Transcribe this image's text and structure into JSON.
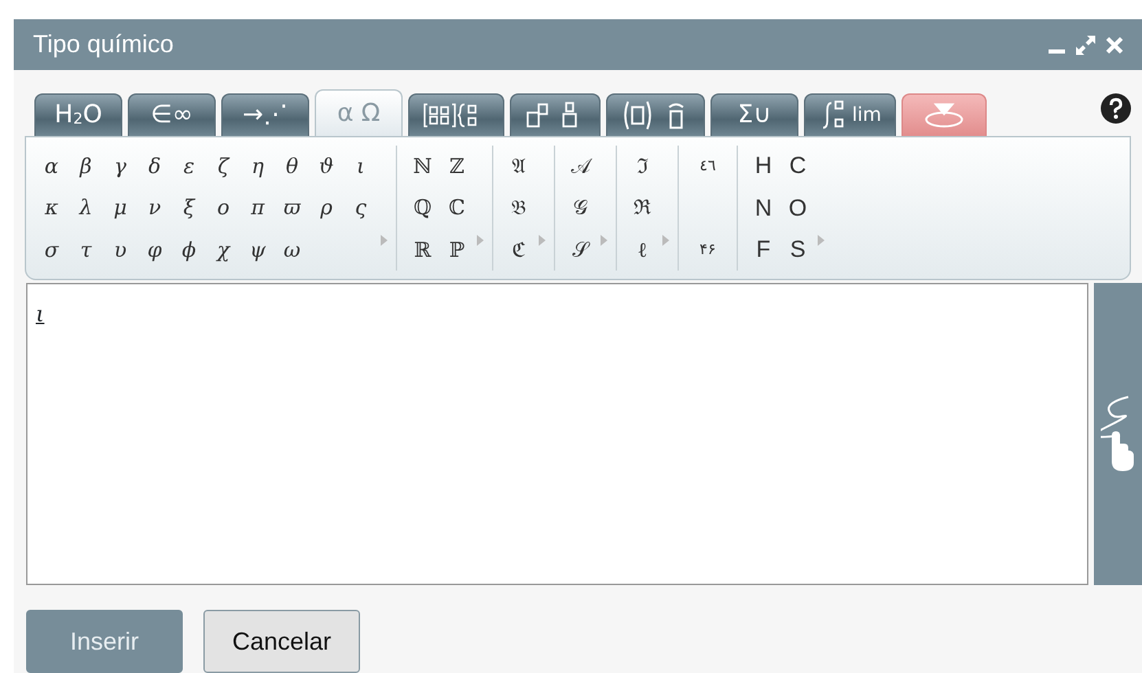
{
  "window": {
    "title": "Tipo químico"
  },
  "tabs": [
    {
      "kind": "text",
      "label": "H$_{2}$O",
      "selected": false
    },
    {
      "kind": "text",
      "label": "∈∞",
      "selected": false
    },
    {
      "kind": "text",
      "label": "→⋰",
      "selected": false
    },
    {
      "kind": "text",
      "label": "α Ω",
      "selected": true
    },
    {
      "kind": "matrix",
      "selected": false
    },
    {
      "kind": "scripts",
      "selected": false
    },
    {
      "kind": "brackets",
      "selected": false
    },
    {
      "kind": "text",
      "label": "Σ∪",
      "selected": false
    },
    {
      "kind": "calculus",
      "label": "lim",
      "selected": false
    },
    {
      "kind": "special",
      "selected": false
    }
  ],
  "palette": [
    {
      "kind": "greek",
      "expandable": true,
      "rows": [
        [
          "α",
          "β",
          "γ",
          "δ",
          "ε",
          "ζ",
          "η",
          "θ",
          "ϑ",
          "ι"
        ],
        [
          "κ",
          "λ",
          "μ",
          "ν",
          "ξ",
          "ο",
          "π",
          "ϖ",
          "ρ",
          "ς"
        ],
        [
          "σ",
          "τ",
          "υ",
          "φ",
          "ϕ",
          "χ",
          "ψ",
          "ω"
        ]
      ]
    },
    {
      "kind": "plain",
      "expandable": true,
      "rows": [
        [
          "ℕ",
          "ℤ"
        ],
        [
          "ℚ",
          "ℂ"
        ],
        [
          "ℝ",
          "ℙ"
        ]
      ]
    },
    {
      "kind": "plain",
      "expandable": true,
      "rows": [
        [
          "𝔄"
        ],
        [
          "𝔅"
        ],
        [
          "ℭ"
        ]
      ]
    },
    {
      "kind": "plain",
      "expandable": true,
      "rows": [
        [
          "𝒜"
        ],
        [
          "𝒢"
        ],
        [
          "𝒮"
        ]
      ]
    },
    {
      "kind": "plain",
      "expandable": true,
      "rows": [
        [
          "ℑ"
        ],
        [
          "ℜ"
        ],
        [
          "ℓ"
        ]
      ]
    },
    {
      "kind": "small",
      "expandable": false,
      "rows": [
        [
          "٤٦"
        ],
        [
          "۴۶"
        ]
      ]
    },
    {
      "kind": "sans",
      "expandable": true,
      "rows": [
        [
          "H",
          "C"
        ],
        [
          "N",
          "O"
        ],
        [
          "F",
          "S"
        ]
      ]
    }
  ],
  "editor": {
    "value": "ι"
  },
  "buttons": [
    {
      "label": "Inserir",
      "kind": "primary"
    },
    {
      "label": "Cancelar",
      "kind": "secondary"
    }
  ]
}
